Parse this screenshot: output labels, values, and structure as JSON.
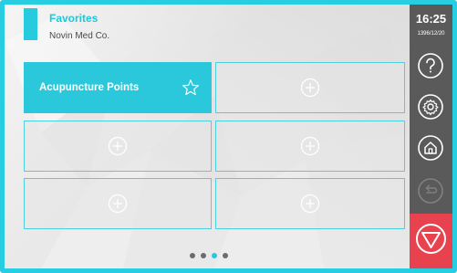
{
  "header": {
    "title": "Favorites",
    "subtitle": "Novin Med Co."
  },
  "tiles": [
    {
      "label": "Acupuncture Points",
      "icon": "star-icon",
      "filled": true
    },
    {
      "label": "",
      "icon": "plus-icon"
    },
    {
      "label": "",
      "icon": "plus-icon"
    },
    {
      "label": "",
      "icon": "plus-icon"
    },
    {
      "label": "",
      "icon": "plus-icon"
    },
    {
      "label": "",
      "icon": "plus-icon"
    }
  ],
  "pagination": {
    "pages": 4,
    "current": 3
  },
  "sidebar": {
    "time": "16:25",
    "date": "1396/12/20",
    "buttons": [
      "help-icon",
      "settings-icon",
      "home-icon",
      "back-icon"
    ],
    "stop_icon": "stop-icon"
  },
  "colors": {
    "accent": "#26ccde",
    "sidebar": "#5a5a5a",
    "stop": "#e8424f",
    "background": "#e9e9e9"
  }
}
